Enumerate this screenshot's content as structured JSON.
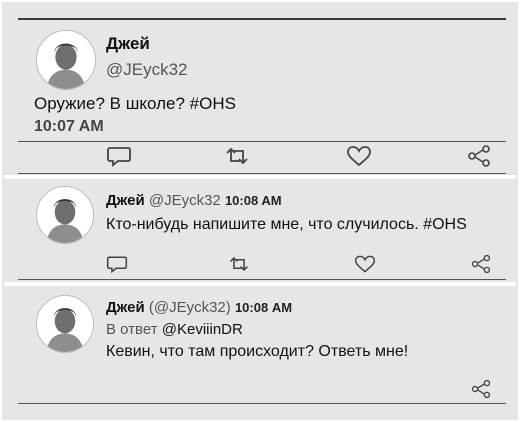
{
  "tweets": [
    {
      "name": "Джей",
      "handle": "@JEyck32",
      "text": "Оружие? В школе? #OHS",
      "time": "10:07 AM"
    },
    {
      "name": "Джей",
      "handle": "@JEyck32",
      "time": "10:08 AM",
      "text": "Кто-нибудь напишите мне, что случилось. #OHS"
    },
    {
      "name": "Джей",
      "handle_wrapped": "(@JEyck32)",
      "time": "10:08 AM",
      "reply_prefix": "В ответ",
      "reply_to": "@KeviiinDR",
      "text": "Кевин, что там происходит? Ответь мне!"
    }
  ],
  "icons": {
    "reply": "reply-icon",
    "retweet": "retweet-icon",
    "like": "heart-icon",
    "share": "share-icon"
  }
}
